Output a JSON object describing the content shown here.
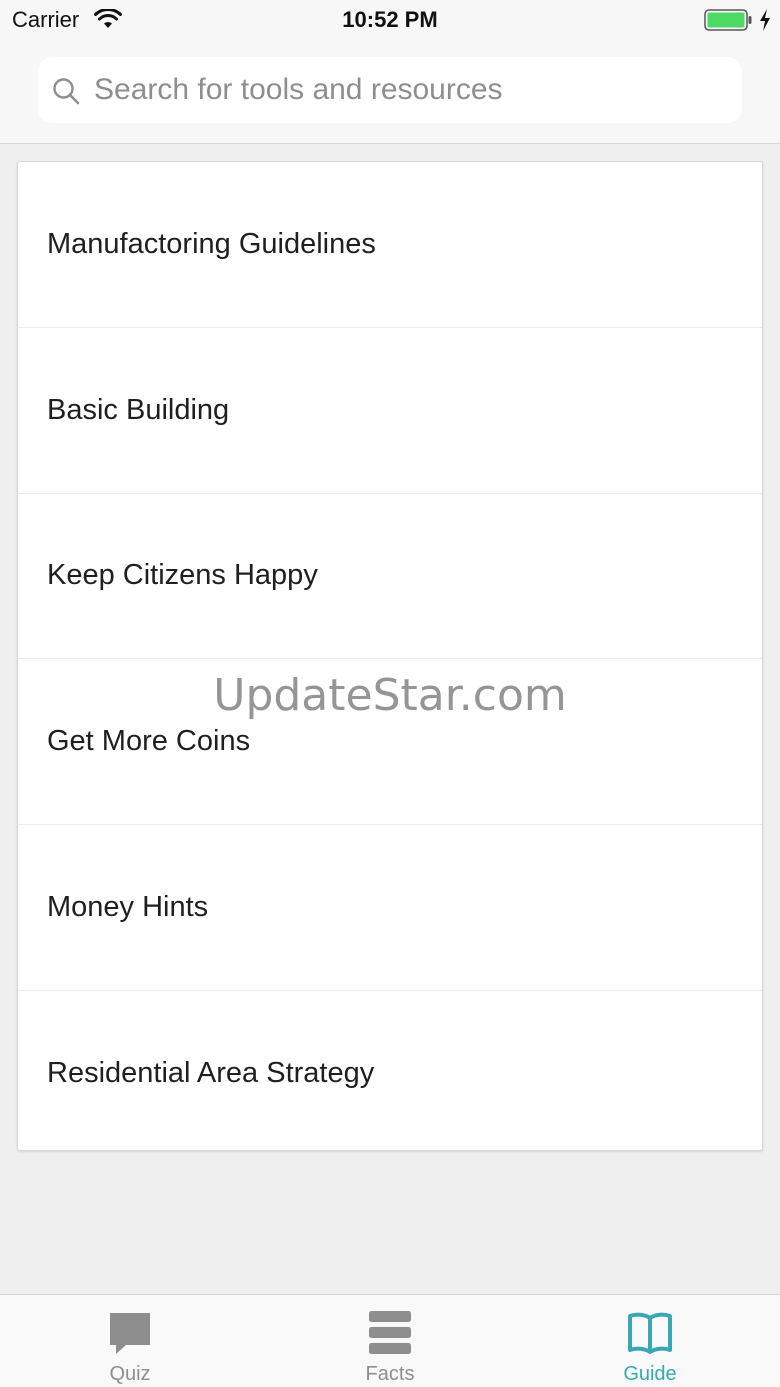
{
  "status_bar": {
    "carrier": "Carrier",
    "time": "10:52 PM",
    "battery_color": "#4cd964"
  },
  "search": {
    "placeholder": "Search for tools and resources",
    "value": ""
  },
  "list": {
    "items": [
      {
        "label": "Manufactoring Guidelines"
      },
      {
        "label": "Basic Building"
      },
      {
        "label": "Keep Citizens Happy"
      },
      {
        "label": "Get More Coins"
      },
      {
        "label": "Money Hints"
      },
      {
        "label": "Residential Area Strategy"
      }
    ]
  },
  "watermark": "UpdateStar.com",
  "tab_bar": {
    "active_color": "#3aa7b5",
    "inactive_color": "#8e8e8e",
    "tabs": [
      {
        "label": "Quiz",
        "icon": "speech-bubble-icon",
        "active": false
      },
      {
        "label": "Facts",
        "icon": "list-icon",
        "active": false
      },
      {
        "label": "Guide",
        "icon": "open-book-icon",
        "active": true
      }
    ]
  }
}
